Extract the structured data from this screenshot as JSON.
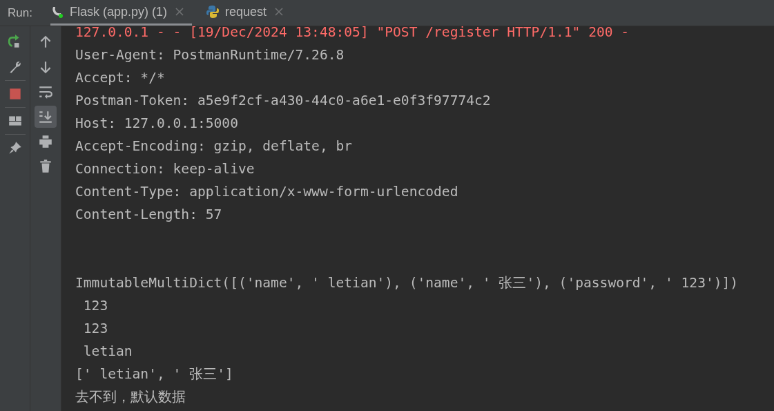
{
  "run_bar": {
    "label": "Run:",
    "tabs": [
      {
        "label": "Flask (app.py) (1)",
        "kind": "flask",
        "selected": true,
        "running": true
      },
      {
        "label": "request",
        "kind": "python",
        "selected": false,
        "running": false
      }
    ]
  },
  "console_toolbar": {
    "soft_wrap": {
      "on": false
    },
    "scroll_to_end": {
      "on": true
    }
  },
  "console": {
    "blocks": [
      {
        "lines": [
          {
            "text": "127.0.0.1 - - [19/Dec/2024 13:48:05] \"POST /register HTTP/1.1\" 200 -",
            "kind": "stderr"
          },
          {
            "text": "User-Agent: PostmanRuntime/7.26.8",
            "kind": "stdout"
          },
          {
            "text": "Accept: */*",
            "kind": "stdout"
          },
          {
            "text": "Postman-Token: a5e9f2cf-a430-44c0-a6e1-e0f3f97774c2",
            "kind": "stdout"
          },
          {
            "text": "Host: 127.0.0.1:5000",
            "kind": "stdout"
          },
          {
            "text": "Accept-Encoding: gzip, deflate, br",
            "kind": "stdout"
          },
          {
            "text": "Connection: keep-alive",
            "kind": "stdout"
          },
          {
            "text": "Content-Type: application/x-www-form-urlencoded",
            "kind": "stdout"
          },
          {
            "text": "Content-Length: 57",
            "kind": "stdout"
          }
        ]
      },
      {
        "lines": [
          {
            "text": "ImmutableMultiDict([('name', ' letian'), ('name', ' 张三'), ('password', ' 123')])",
            "kind": "stdout"
          },
          {
            "text": " 123",
            "kind": "stdout"
          },
          {
            "text": " 123",
            "kind": "stdout"
          },
          {
            "text": " letian",
            "kind": "stdout"
          },
          {
            "text": "[' letian', ' 张三']",
            "kind": "stdout"
          },
          {
            "text": "去不到，默认数据",
            "kind": "stdout"
          }
        ]
      }
    ]
  }
}
